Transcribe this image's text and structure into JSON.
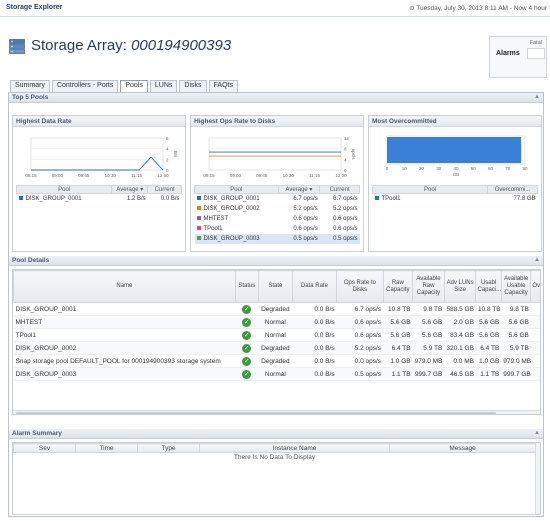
{
  "app": {
    "title": "Storage Explorer",
    "timestamp": "Tuesday, July 30, 2013 8:11 AM - Now 4 hour"
  },
  "header": {
    "title_prefix": "Storage Array:",
    "array_name": "000194900393",
    "alarms_label": "Alarms",
    "fatal_label": "Fatal"
  },
  "tabs": [
    {
      "label": "Summary",
      "active": false
    },
    {
      "label": "Controllers - Ports",
      "active": false
    },
    {
      "label": "Pools",
      "active": true
    },
    {
      "label": "LUNs",
      "active": false
    },
    {
      "label": "Disks",
      "active": false
    },
    {
      "label": "FAQts",
      "active": false
    }
  ],
  "top5": {
    "section_title": "Top 5 Pools",
    "data_rate": {
      "title": "Highest Data Rate",
      "axis_unit": "B/s",
      "col_pool": "Pool",
      "col_avg": "Average ▾",
      "col_cur": "Current",
      "rows": [
        {
          "pool": "DISK_GROUP_0001",
          "avg": "1.2 B/s",
          "cur": "0.0 B/s",
          "color": "#1f6fd1"
        }
      ]
    },
    "ops_rate": {
      "title": "Highest Ops Rate to Disks",
      "axis_unit": "ops/s",
      "col_pool": "Pool",
      "col_avg": "Average ▾",
      "col_cur": "Current",
      "rows": [
        {
          "pool": "DISK_GROUP_0001",
          "avg": "6.7 ops/s",
          "cur": "6.7 ops/s",
          "color": "#1f6fd1"
        },
        {
          "pool": "DISK_GROUP_0002",
          "avg": "5.2 ops/s",
          "cur": "5.2 ops/s",
          "color": "#e8851a"
        },
        {
          "pool": "MHTEST",
          "avg": "0.6 ops/s",
          "cur": "0.6 ops/s",
          "color": "#9b59b6"
        },
        {
          "pool": "TPool1",
          "avg": "0.6 ops/s",
          "cur": "0.6 ops/s",
          "color": "#e8447a"
        },
        {
          "pool": "DISK_GROUP_0003",
          "avg": "0.5 ops/s",
          "cur": "0.5 ops/s",
          "color": "#5f9e3a"
        }
      ]
    },
    "overcommitted": {
      "title": "Most Overcommitted",
      "axis_unit": "GB",
      "col_pool": "Pool",
      "col_over": "Overcommi...",
      "rows": [
        {
          "pool": "TPool1",
          "over": "77.8 GB",
          "color": "#1f6fd1"
        }
      ]
    }
  },
  "chart_data": [
    {
      "type": "line",
      "title": "Highest Data Rate",
      "x": [
        "09:15",
        "09:30",
        "09:45",
        "10:00",
        "10:15",
        "10:30",
        "10:45",
        "11:00",
        "11:15",
        "11:30",
        "11:45",
        "12:00"
      ],
      "x_ticks": [
        "09:15",
        "09:00",
        "09:45",
        "10:30",
        "11:15",
        "12:00"
      ],
      "y_ticks": [
        "0",
        "2",
        "4",
        "6"
      ],
      "ylim": [
        0,
        6
      ],
      "ylabel": "B/s",
      "series": [
        {
          "name": "DISK_GROUP_0001",
          "color": "#1f6fd1",
          "values": [
            0,
            0,
            0,
            0,
            0,
            0,
            0,
            0,
            0,
            0,
            2.4,
            0
          ]
        }
      ]
    },
    {
      "type": "line",
      "title": "Highest Ops Rate to Disks",
      "x": [
        "09:15",
        "09:30",
        "09:45",
        "10:00",
        "10:15",
        "10:30",
        "10:45",
        "11:00",
        "11:15",
        "11:30",
        "11:45",
        "12:00"
      ],
      "x_ticks": [
        "09:15",
        "09:00",
        "09:45",
        "10:30",
        "11:15",
        "12:00"
      ],
      "y_ticks": [
        "0",
        "4",
        "8",
        "12"
      ],
      "ylim": [
        0,
        12
      ],
      "ylabel": "ops/s",
      "series": [
        {
          "name": "DISK_GROUP_0001",
          "color": "#1f6fd1",
          "values": [
            6.7,
            6.7,
            6.7,
            6.7,
            6.7,
            6.7,
            6.7,
            6.7,
            6.7,
            6.7,
            6.7,
            6.7
          ]
        },
        {
          "name": "DISK_GROUP_0002",
          "color": "#e8851a",
          "values": [
            5.2,
            5.2,
            5.2,
            5.2,
            5.2,
            5.2,
            5.2,
            5.2,
            5.2,
            5.2,
            5.2,
            5.2
          ]
        }
      ]
    },
    {
      "type": "bar",
      "title": "Most Overcommitted",
      "categories": [
        "TPool1"
      ],
      "values": [
        77.8
      ],
      "x_ticks": [
        "0",
        "10",
        "20",
        "30",
        "40",
        "50",
        "60",
        "70",
        "80"
      ],
      "xlim": [
        0,
        80
      ],
      "xlabel": "GB",
      "color": "#3a7fd8"
    }
  ],
  "pool_details": {
    "section_title": "Pool Details",
    "columns": [
      "Name",
      "Status",
      "State",
      "Data Rate",
      "Ops Rate to Disks",
      "Raw Capacity",
      "Available Raw Capacity",
      "Adv LUNs Size",
      "Usabl Capaci...",
      "Available Usable Capacity",
      "Ov"
    ],
    "rows": [
      {
        "name": "DISK_GROUP_0001",
        "state": "Degraded",
        "data_rate": "0.0 B/s",
        "ops": "6.7 ops/s",
        "raw": "10.8 TB",
        "avail_raw": "9.8 TB",
        "adv": "588.5 GB",
        "usable": "10.8 TB",
        "avail_usable": "9.8 TB"
      },
      {
        "name": "MHTEST",
        "state": "Normal",
        "data_rate": "0.0 B/s",
        "ops": "0.6 ops/s",
        "raw": "5.6 GB",
        "avail_raw": "5.6 GB",
        "adv": "2.0 GB",
        "usable": "5.6 GB",
        "avail_usable": "5.6 GB"
      },
      {
        "name": "TPool1",
        "state": "Normal",
        "data_rate": "0.0 B/s",
        "ops": "0.6 ops/s",
        "raw": "5.6 GB",
        "avail_raw": "5.6 GB",
        "adv": "83.4 GB",
        "usable": "5.6 GB",
        "avail_usable": "5.6 GB"
      },
      {
        "name": "DISK_GROUP_0002",
        "state": "Degraded",
        "data_rate": "0.0 B/s",
        "ops": "5.2 ops/s",
        "raw": "6.4 TB",
        "avail_raw": "5.9 TB",
        "adv": "320.1 GB",
        "usable": "6.4 TB",
        "avail_usable": "5.9 TB"
      },
      {
        "name": "Snap storage pool DEFAULT_POOL for 000194900393 storage system",
        "state": "Degraded",
        "data_rate": "0.0 B/s",
        "ops": "0.0 ops/s",
        "raw": "1.0 GB",
        "avail_raw": "979.0 MB",
        "adv": "0.0 MB",
        "usable": "1.0 GB",
        "avail_usable": "979.0 MB"
      },
      {
        "name": "DISK_GROUP_0003",
        "state": "Normal",
        "data_rate": "0.0 B/s",
        "ops": "0.5 ops/s",
        "raw": "1.1 TB",
        "avail_raw": "999.7 GB",
        "adv": "46.5 GB",
        "usable": "1.1 TB",
        "avail_usable": "999.7 GB"
      }
    ]
  },
  "alarm_summary": {
    "section_title": "Alarm Summary",
    "columns": [
      "Sev",
      "Time",
      "Type",
      "Instance Name",
      "Message"
    ],
    "empty_text": "There Is No Data To Display"
  }
}
